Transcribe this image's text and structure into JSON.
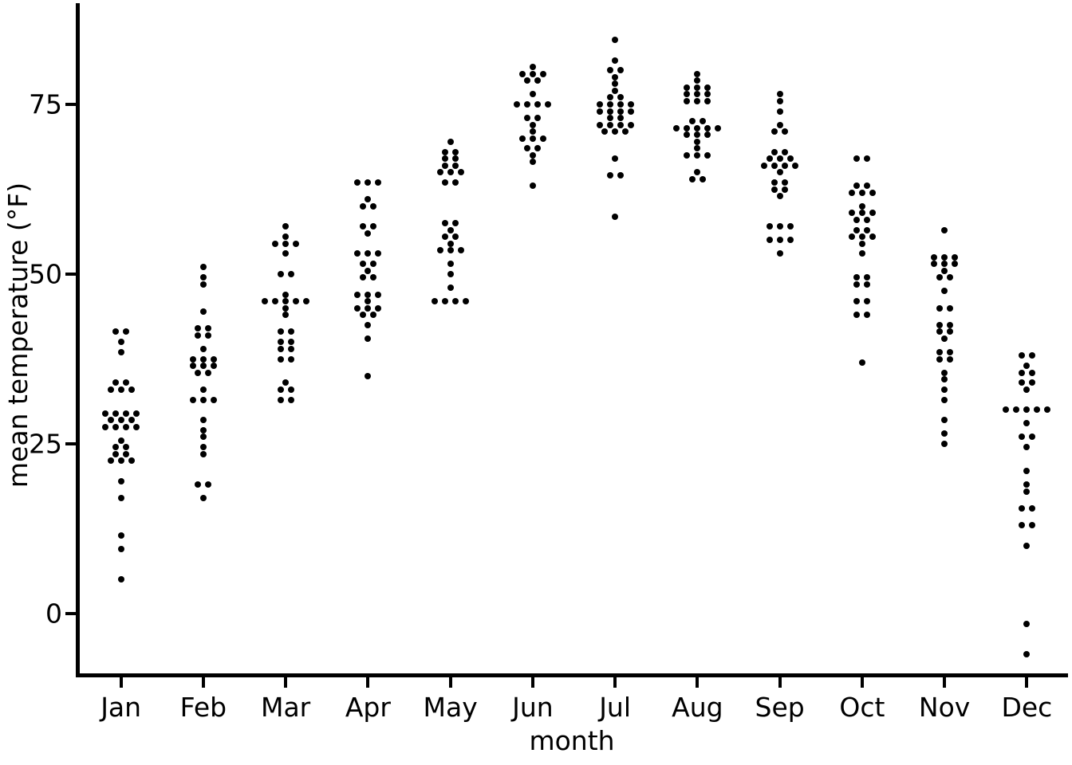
{
  "chart_data": {
    "type": "scatter",
    "title": "",
    "subtitle": "",
    "xlabel": "month",
    "ylabel": "mean temperature (°F)",
    "plot_style": "dotplot / jittered strip chart (one point per year per month)",
    "grid": false,
    "legend": null,
    "categories": [
      "Jan",
      "Feb",
      "Mar",
      "Apr",
      "May",
      "Jun",
      "Jul",
      "Aug",
      "Sep",
      "Oct",
      "Nov",
      "Dec"
    ],
    "x_tick_labels": [
      "Jan",
      "Feb",
      "Mar",
      "Apr",
      "May",
      "Jun",
      "Jul",
      "Aug",
      "Sep",
      "Oct",
      "Nov",
      "Dec"
    ],
    "y_tick_labels": [
      "0",
      "25",
      "50",
      "75"
    ],
    "y_ticks": [
      0,
      25,
      50,
      75
    ],
    "ylim": [
      -11,
      90
    ],
    "xlim_categories": 12,
    "point_color": "#000000",
    "background_color": "#ffffff",
    "axis_color": "#000000",
    "series": [
      {
        "name": "Jan",
        "values": [
          41.5,
          41.5,
          40.0,
          38.5,
          34.0,
          33.5,
          33.0,
          33.0,
          32.5,
          29.5,
          29.5,
          29.0,
          29.0,
          28.5,
          28.5,
          28.0,
          27.5,
          27.5,
          27.0,
          27.0,
          25.5,
          24.5,
          24.0,
          23.5,
          23.0,
          22.5,
          22.0,
          22.0,
          19.5,
          17.0,
          11.5,
          9.5,
          5.0
        ]
      },
      {
        "name": "Feb",
        "values": [
          51.0,
          49.5,
          48.5,
          44.5,
          42.0,
          41.5,
          41.0,
          40.5,
          39.0,
          37.5,
          37.5,
          37.0,
          36.5,
          36.0,
          36.0,
          35.5,
          35.0,
          33.0,
          31.5,
          31.0,
          31.0,
          28.5,
          27.0,
          26.0,
          24.5,
          23.5,
          19.0,
          18.5,
          17.0
        ]
      },
      {
        "name": "Mar",
        "values": [
          57.0,
          55.5,
          54.5,
          54.0,
          54.0,
          53.0,
          50.0,
          50.0,
          47.0,
          46.0,
          46.0,
          45.5,
          45.5,
          45.5,
          45.0,
          44.0,
          41.5,
          41.5,
          40.0,
          39.5,
          39.0,
          38.5,
          37.5,
          37.5,
          34.0,
          33.0,
          32.5,
          31.5,
          31.0
        ]
      },
      {
        "name": "Apr",
        "values": [
          63.5,
          63.5,
          63.5,
          61.0,
          60.0,
          60.0,
          57.0,
          57.0,
          56.0,
          53.0,
          52.5,
          52.5,
          51.5,
          51.5,
          50.5,
          49.5,
          49.0,
          47.0,
          47.0,
          47.0,
          46.0,
          45.0,
          45.0,
          44.5,
          44.0,
          43.5,
          42.5,
          40.5,
          35.0
        ]
      },
      {
        "name": "May",
        "values": [
          69.5,
          68.0,
          68.0,
          67.0,
          66.5,
          66.0,
          66.0,
          65.0,
          64.5,
          64.5,
          63.5,
          63.5,
          57.5,
          57.5,
          56.5,
          55.5,
          55.0,
          54.5,
          53.5,
          53.0,
          53.0,
          51.5,
          50.0,
          48.0,
          46.0,
          45.5,
          45.5,
          45.5
        ]
      },
      {
        "name": "Jun",
        "values": [
          80.5,
          79.5,
          79.5,
          79.5,
          78.5,
          78.5,
          76.5,
          75.0,
          75.0,
          74.5,
          74.5,
          73.0,
          72.5,
          72.0,
          71.0,
          70.0,
          69.5,
          69.5,
          68.5,
          68.0,
          67.5,
          66.5,
          63.0
        ]
      },
      {
        "name": "Jul",
        "values": [
          84.5,
          81.5,
          80.0,
          80.0,
          79.0,
          78.0,
          77.0,
          76.0,
          76.0,
          75.0,
          74.5,
          74.5,
          74.5,
          74.0,
          73.5,
          73.5,
          73.5,
          73.0,
          72.5,
          72.0,
          72.0,
          71.5,
          71.5,
          71.0,
          70.5,
          70.5,
          67.0,
          64.5,
          64.5,
          58.5
        ]
      },
      {
        "name": "Aug",
        "values": [
          79.5,
          78.5,
          77.5,
          77.0,
          77.0,
          76.5,
          76.0,
          76.0,
          75.5,
          75.0,
          75.0,
          72.5,
          72.5,
          71.5,
          71.5,
          71.5,
          71.0,
          71.0,
          70.5,
          70.5,
          70.5,
          69.5,
          68.5,
          67.5,
          67.0,
          67.0,
          65.0,
          64.0,
          63.5
        ]
      },
      {
        "name": "Sep",
        "values": [
          76.5,
          75.5,
          74.0,
          72.0,
          71.0,
          71.0,
          68.0,
          68.0,
          67.0,
          67.0,
          66.5,
          66.0,
          66.0,
          65.5,
          65.5,
          65.0,
          63.5,
          63.0,
          62.5,
          62.5,
          61.5,
          57.0,
          57.0,
          57.0,
          55.0,
          55.0,
          54.5,
          53.0
        ]
      },
      {
        "name": "Oct",
        "values": [
          67.0,
          67.0,
          63.0,
          63.0,
          62.0,
          61.5,
          61.5,
          60.0,
          59.0,
          58.5,
          58.5,
          58.0,
          57.5,
          56.5,
          56.0,
          55.5,
          55.5,
          55.0,
          54.5,
          53.0,
          49.5,
          49.0,
          48.5,
          48.0,
          46.0,
          45.5,
          44.0,
          43.5,
          37.0
        ]
      },
      {
        "name": "Nov",
        "values": [
          56.5,
          52.5,
          52.5,
          52.5,
          51.5,
          51.0,
          51.0,
          50.5,
          49.5,
          49.5,
          47.5,
          45.0,
          45.0,
          42.5,
          42.0,
          41.5,
          41.0,
          40.5,
          38.5,
          38.5,
          37.5,
          37.0,
          35.5,
          34.5,
          33.0,
          31.5,
          28.5,
          26.5,
          25.0
        ]
      },
      {
        "name": "Dec",
        "values": [
          38.0,
          38.0,
          36.5,
          35.5,
          35.5,
          34.0,
          34.0,
          33.0,
          30.0,
          30.0,
          29.5,
          29.5,
          29.5,
          28.0,
          26.0,
          26.0,
          24.5,
          21.0,
          19.0,
          18.0,
          15.5,
          15.5,
          13.0,
          12.5,
          10.0,
          -1.5,
          -6.0
        ]
      }
    ]
  },
  "axes": {
    "y_title": "mean temperature (°F)",
    "x_title": "month",
    "y_tick_0": "0",
    "y_tick_25": "25",
    "y_tick_50": "50",
    "y_tick_75": "75",
    "x_tick_1": "Jan",
    "x_tick_2": "Feb",
    "x_tick_3": "Mar",
    "x_tick_4": "Apr",
    "x_tick_5": "May",
    "x_tick_6": "Jun",
    "x_tick_7": "Jul",
    "x_tick_8": "Aug",
    "x_tick_9": "Sep",
    "x_tick_10": "Oct",
    "x_tick_11": "Nov",
    "x_tick_12": "Dec"
  }
}
